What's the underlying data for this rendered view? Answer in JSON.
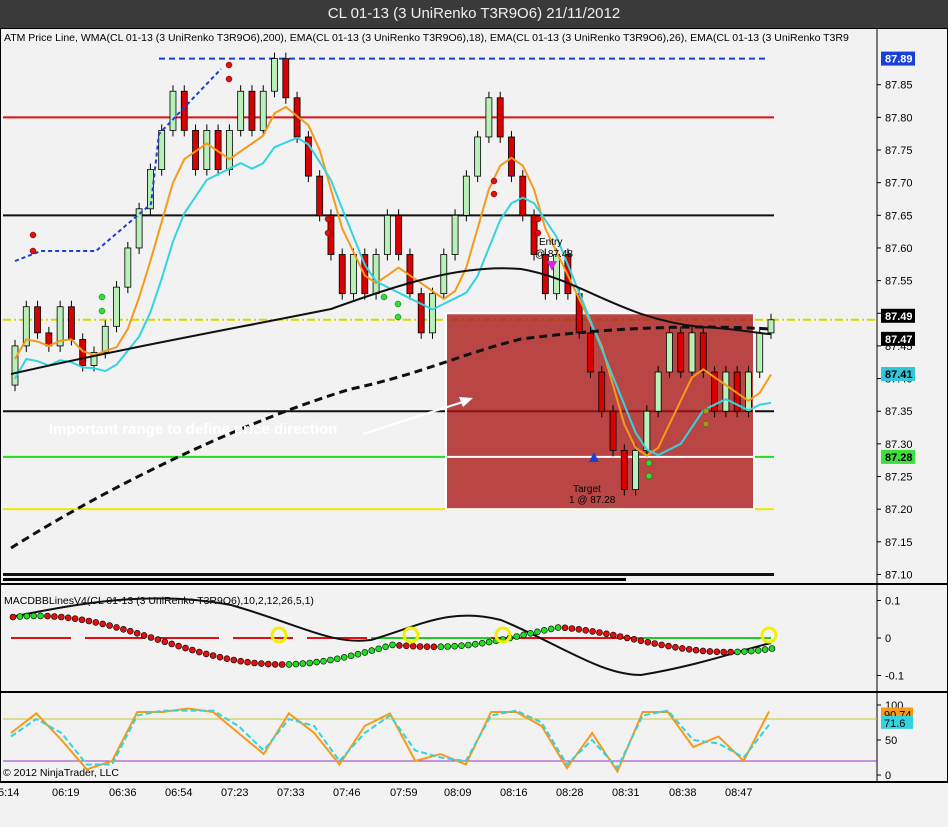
{
  "window": {
    "title": "CL 01-13 (3 UniRenko T3R9O6)  21/11/2012"
  },
  "price_panel": {
    "indicator_legend": "ATM Price Line, WMA(CL 01-13 (3 UniRenko T3R9O6),200), EMA(CL 01-13 (3 UniRenko T3R9O6),18), EMA(CL 01-13 (3 UniRenko T3R9O6),26), EMA(CL 01-13 (3 UniRenko T3R9",
    "annotation": "Important range to define price direction",
    "entry_label": "Entry",
    "entry_price": "@ 87.48",
    "target_label": "Target",
    "target_price": "1 @ 87.28",
    "price_tags": [
      {
        "value": "87.89",
        "color": "#1a3fd6",
        "text_color": "#ffffff"
      },
      {
        "value": "87.49",
        "color": "#000000",
        "text_color": "#ffffff"
      },
      {
        "value": "87.47",
        "color": "#000000",
        "text_color": "#ffffff"
      },
      {
        "value": "87.41",
        "color": "#33c6d8",
        "text_color": "#000000"
      },
      {
        "value": "87.28",
        "color": "#3ee03e",
        "text_color": "#000000"
      }
    ]
  },
  "macd_panel": {
    "legend": "MACDBBLinesV4(CL 01-13 (3 UniRenko T3R9O6),10,2,12,26,5,1)"
  },
  "stoch_panel": {
    "tags": [
      {
        "value": "90.74",
        "color": "#f59a1a"
      },
      {
        "value": "71.6",
        "color": "#33d3e0"
      }
    ]
  },
  "footer": {
    "copyright": "© 2012 NinjaTrader, LLC"
  },
  "chart_data": [
    {
      "type": "candlestick",
      "name": "price",
      "ylim": [
        87.09,
        87.92
      ],
      "y_ticks": [
        "87.85",
        "87.80",
        "87.75",
        "87.70",
        "87.65",
        "87.60",
        "87.55",
        "87.50",
        "87.45",
        "87.40",
        "87.35",
        "87.30",
        "87.25",
        "87.20",
        "87.15",
        "87.10"
      ],
      "x_ticks": [
        "5:14",
        "06:19",
        "06:36",
        "06:54",
        "07:23",
        "07:33",
        "07:46",
        "07:59",
        "08:09",
        "08:16",
        "08:28",
        "08:31",
        "08:38",
        "08:47"
      ],
      "closes": [
        87.45,
        87.51,
        87.47,
        87.45,
        87.51,
        87.46,
        87.42,
        87.44,
        87.48,
        87.54,
        87.6,
        87.66,
        87.72,
        87.78,
        87.84,
        87.78,
        87.72,
        87.78,
        87.72,
        87.78,
        87.84,
        87.78,
        87.84,
        87.89,
        87.83,
        87.77,
        87.71,
        87.65,
        87.59,
        87.53,
        87.59,
        87.53,
        87.59,
        87.65,
        87.59,
        87.53,
        87.47,
        87.53,
        87.59,
        87.65,
        87.71,
        87.77,
        87.83,
        87.77,
        87.71,
        87.65,
        87.59,
        87.53,
        87.59,
        87.53,
        87.47,
        87.41,
        87.35,
        87.29,
        87.23,
        87.29,
        87.35,
        87.41,
        87.47,
        87.41,
        87.47,
        87.41,
        87.35,
        87.41,
        87.35,
        87.41,
        87.47,
        87.49
      ],
      "horizontal_lines": [
        {
          "value": 87.89,
          "color": "#1a3fd6",
          "style": "dashed"
        },
        {
          "value": 87.8,
          "color": "#e01010",
          "style": "solid"
        },
        {
          "value": 87.65,
          "color": "#111111",
          "style": "solid"
        },
        {
          "value": 87.49,
          "color": "#d8d800",
          "style": "dashdot"
        },
        {
          "value": 87.35,
          "color": "#111111",
          "style": "solid"
        },
        {
          "value": 87.28,
          "color": "#22dd22",
          "style": "solid"
        },
        {
          "value": 87.2,
          "color": "#e8e800",
          "style": "solid"
        },
        {
          "value": 87.1,
          "color": "#111111",
          "style": "solid"
        }
      ],
      "range_box": {
        "top": 87.5,
        "bottom": 87.2,
        "mid": 87.28
      }
    },
    {
      "type": "line",
      "name": "macd",
      "ylim": [
        -0.12,
        0.12
      ],
      "y_ticks": [
        "0.1",
        "0",
        "-0.1"
      ]
    },
    {
      "type": "line",
      "name": "stochastics",
      "ylim": [
        0,
        100
      ],
      "y_ticks": [
        "100",
        "50",
        "0"
      ],
      "series": [
        {
          "values": [
            60,
            88,
            50,
            8,
            20,
            90,
            90,
            95,
            90,
            60,
            30,
            88,
            60,
            15,
            70,
            88,
            20,
            30,
            15,
            90,
            90,
            70,
            10,
            60,
            5,
            90,
            90,
            40,
            55,
            20,
            90.74
          ]
        },
        {
          "values": [
            55,
            80,
            60,
            15,
            15,
            85,
            92,
            92,
            92,
            70,
            35,
            80,
            70,
            20,
            60,
            85,
            35,
            25,
            20,
            85,
            92,
            75,
            15,
            50,
            10,
            85,
            92,
            50,
            45,
            25,
            71.6
          ]
        }
      ]
    }
  ]
}
